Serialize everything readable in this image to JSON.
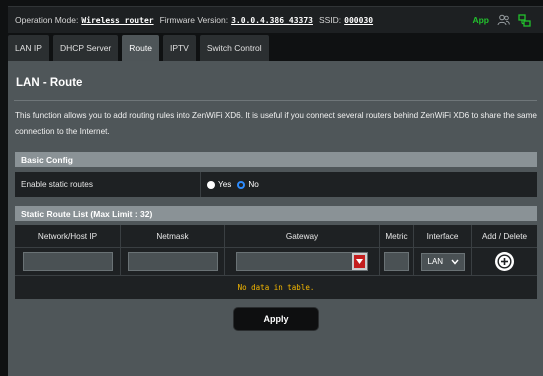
{
  "topbar": {
    "operation_mode_label": "Operation Mode:",
    "operation_mode_value": "Wireless router",
    "firmware_label": "Firmware Version:",
    "firmware_value": "3.0.0.4.386_43373",
    "ssid_label": "SSID:",
    "ssid_value": "000030",
    "app_label": "App",
    "icons": [
      "user-group-icon",
      "network-status-icon"
    ],
    "app_color": "#22c12d"
  },
  "tabs": [
    {
      "label": "LAN IP",
      "active": false
    },
    {
      "label": "DHCP Server",
      "active": false
    },
    {
      "label": "Route",
      "active": true
    },
    {
      "label": "IPTV",
      "active": false
    },
    {
      "label": "Switch Control",
      "active": false
    }
  ],
  "page": {
    "title": "LAN - Route",
    "description": "This function allows you to add routing rules into ZenWiFi XD6. It is useful if you connect several routers behind ZenWiFi XD6 to share the same connection to the Internet."
  },
  "basic_config": {
    "header": "Basic Config",
    "enable_label": "Enable static routes",
    "option_yes": "Yes",
    "option_no": "No",
    "selected": "No"
  },
  "route_list": {
    "header": "Static Route List (Max Limit : 32)",
    "columns": [
      "Network/Host IP",
      "Netmask",
      "Gateway",
      "Metric",
      "Interface",
      "Add / Delete"
    ],
    "interface_value": "LAN",
    "empty_message": "No data in table."
  },
  "apply_label": "Apply",
  "colors": {
    "accent_blue": "#2d8cff",
    "empty_text": "#f5b800",
    "dropdown_red": "#c41e1e"
  }
}
